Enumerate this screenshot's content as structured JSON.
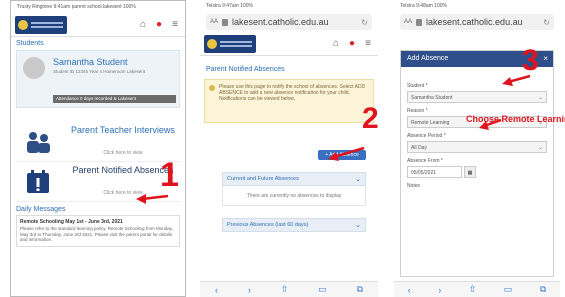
{
  "phone1": {
    "statusbar": "Trusty Ringtone 9:41am  parent school.lakesent  100%",
    "section_students": "Students",
    "student": {
      "name": "Samantha Student",
      "meta": "Student ID 12345  Year 4  Homeroom Lakesent",
      "bar": "Attendance 0 days recorded & Lakesent"
    },
    "tiles": [
      {
        "title": "Parent Teacher Interviews",
        "sub": "Click here to view"
      },
      {
        "title": "Parent Notified Absences",
        "sub": "Click here to view"
      }
    ],
    "messages_heading": "Daily Messages",
    "message": {
      "title": "Remote Schooling May 1st - June 3rd, 2021",
      "body": "Please refer to the standard learning policy, Remote Schooling from Monday, May 3rd to Thursday, June 3rd 2021. Please visit the parent portal for details and information."
    }
  },
  "phone2": {
    "statusbar": "Telstra  9:47am  100%",
    "url": "lakesent.catholic.edu.au",
    "page_title": "Parent Notified Absences",
    "note": "Please use this page to notify the school of absences. Select ADD ABSENCE to add a new absence notification for your child. Notifications can be viewed below.",
    "add_button": "+ Add Absence",
    "current_panel": "Current and Future Absences",
    "current_empty": "There are currently no absences to display",
    "previous_panel": "Previous Absences (last 60 days)"
  },
  "phone3": {
    "statusbar": "Telstra  9:48am  100%",
    "url": "lakesent.catholic.edu.au",
    "modal_title": "Add Absence",
    "student_label": "Student *",
    "student_value": "Samantha Student",
    "reason_label": "Reason *",
    "reason_value": "Remote Learning",
    "period_label": "Absence Period *",
    "period_value": "All Day",
    "from_label": "Absence From *",
    "from_value": "05/05/2021",
    "notes_label": "Notes"
  },
  "callouts": {
    "one": "1",
    "two": "2",
    "three": "3",
    "instruction": "Choose Remote Learning"
  },
  "colors": {
    "callout": "#e0141e",
    "brand_navy": "#1f3f7a",
    "link_blue": "#2d6fb5"
  }
}
